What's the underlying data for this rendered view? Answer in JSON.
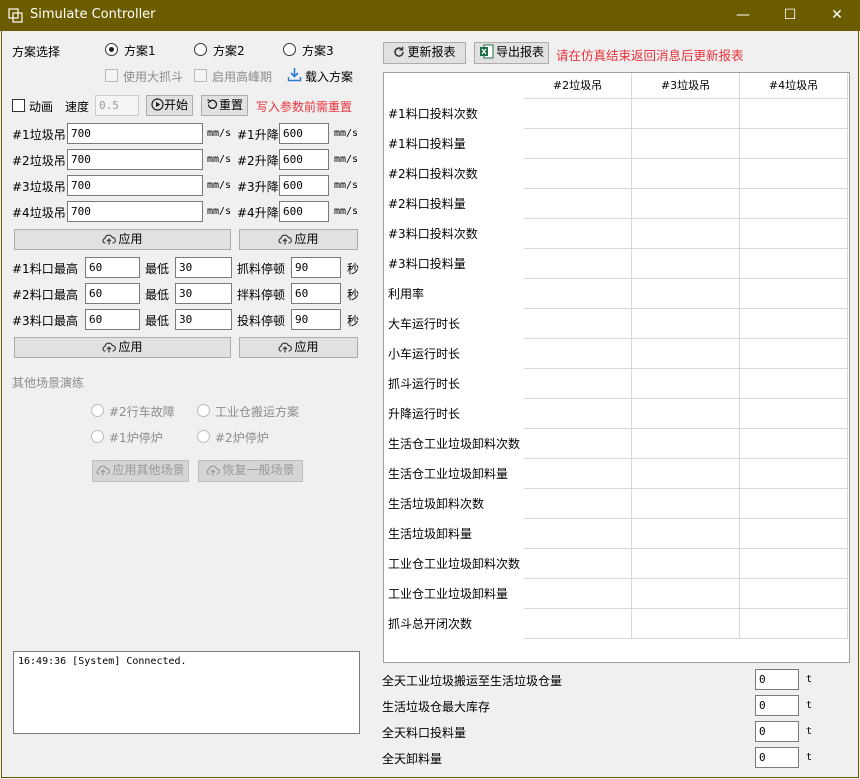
{
  "window": {
    "title": "Simulate Controller",
    "minimize": "—",
    "maximize": "☐",
    "close": "✕"
  },
  "plan": {
    "label": "方案选择",
    "options": [
      "方案1",
      "方案2",
      "方案3"
    ],
    "selected": 0,
    "use_big_grab": "使用大抓斗",
    "enable_peak": "启用高峰期",
    "load_plan": "载入方案"
  },
  "anim": {
    "label": "动画",
    "speed_label": "速度",
    "speed_value": "0.5",
    "start": "开始",
    "reset": "重置",
    "note": "写入参数前需重置"
  },
  "cranes": [
    {
      "label": "#1垃圾吊",
      "value": "700",
      "unit": "mm/s",
      "lift_label": "#1升降",
      "lift_value": "600",
      "lift_unit": "mm/s"
    },
    {
      "label": "#2垃圾吊",
      "value": "700",
      "unit": "mm/s",
      "lift_label": "#2升降",
      "lift_value": "600",
      "lift_unit": "mm/s"
    },
    {
      "label": "#3垃圾吊",
      "value": "700",
      "unit": "mm/s",
      "lift_label": "#3升降",
      "lift_value": "600",
      "lift_unit": "mm/s"
    },
    {
      "label": "#4垃圾吊",
      "value": "700",
      "unit": "mm/s",
      "lift_label": "#4升降",
      "lift_value": "600",
      "lift_unit": "mm/s"
    }
  ],
  "apply_label": "应用",
  "ports": [
    {
      "label": "#1料口",
      "high_label": "最高",
      "high": "60",
      "low_label": "最低",
      "low": "30",
      "pause_label": "抓料停顿",
      "pause": "90",
      "sec": "秒"
    },
    {
      "label": "#2料口",
      "high_label": "最高",
      "high": "60",
      "low_label": "最低",
      "low": "30",
      "pause_label": "拌料停顿",
      "pause": "60",
      "sec": "秒"
    },
    {
      "label": "#3料口",
      "high_label": "最高",
      "high": "60",
      "low_label": "最低",
      "low": "30",
      "pause_label": "投料停顿",
      "pause": "90",
      "sec": "秒"
    }
  ],
  "scenarios": {
    "title": "其他场景演练",
    "options": [
      "#2行车故障",
      "工业仓搬运方案",
      "#1炉停炉",
      "#2炉停炉"
    ],
    "apply": "应用其他场景",
    "restore": "恢复一般场景"
  },
  "log": [
    "16:49:36 [System] Connected."
  ],
  "report": {
    "refresh": "更新报表",
    "export": "导出报表",
    "note": "请在仿真结束返回消息后更新报表",
    "columns": [
      "#2垃圾吊",
      "#3垃圾吊",
      "#4垃圾吊"
    ],
    "rows": [
      "#1料口投料次数",
      "#1料口投料量",
      "#2料口投料次数",
      "#2料口投料量",
      "#3料口投料次数",
      "#3料口投料量",
      "利用率",
      "大车运行时长",
      "小车运行时长",
      "抓斗运行时长",
      "升降运行时长",
      "生活仓工业垃圾卸料次数",
      "生活仓工业垃圾卸料量",
      "生活垃圾卸料次数",
      "生活垃圾卸料量",
      "工业仓工业垃圾卸料次数",
      "工业仓工业垃圾卸料量",
      "抓斗总开闭次数"
    ]
  },
  "summary": [
    {
      "label": "全天工业垃圾搬运至生活垃圾仓量",
      "value": "0",
      "unit": "t"
    },
    {
      "label": "生活垃圾仓最大库存",
      "value": "0",
      "unit": "t"
    },
    {
      "label": "全天料口投料量",
      "value": "0",
      "unit": "t"
    },
    {
      "label": "全天卸料量",
      "value": "0",
      "unit": "t"
    }
  ]
}
